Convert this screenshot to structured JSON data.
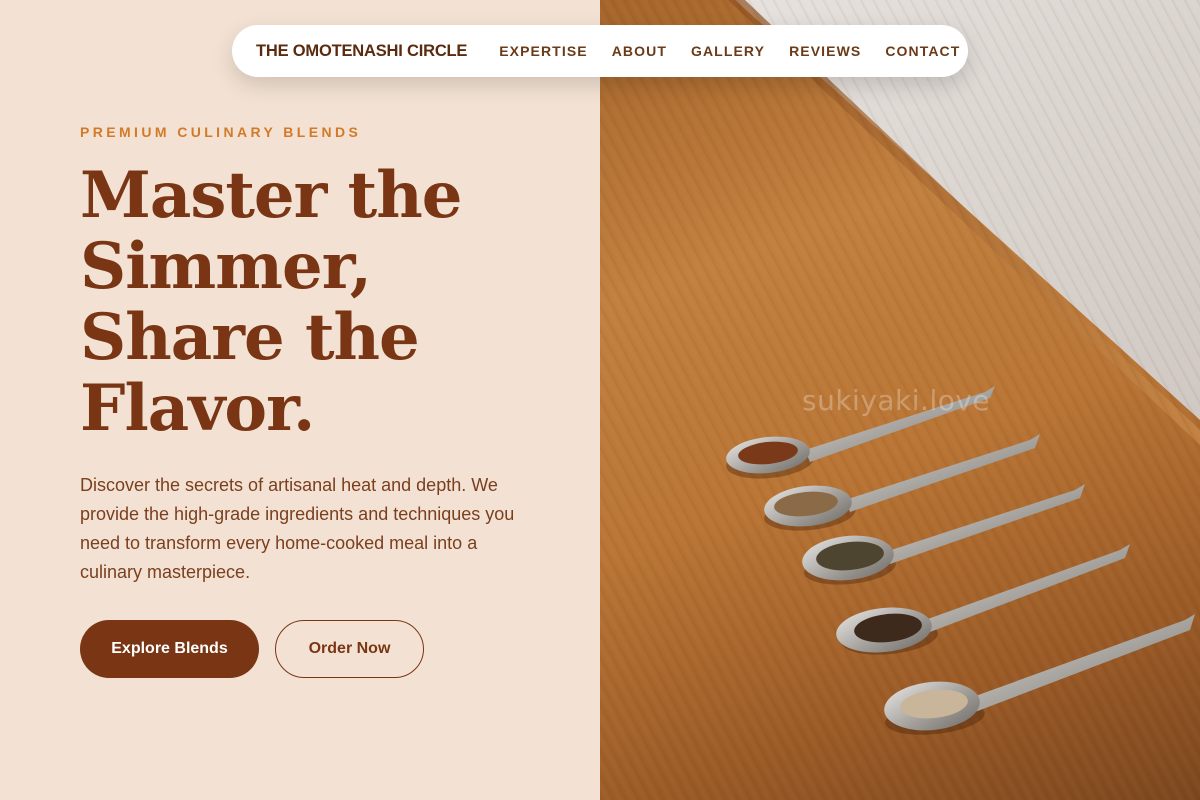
{
  "nav": {
    "brand": "THE OMOTENASHI CIRCLE",
    "links": [
      "EXPERTISE",
      "ABOUT",
      "GALLERY",
      "REVIEWS",
      "CONTACT"
    ]
  },
  "hero": {
    "kicker": "PREMIUM CULINARY BLENDS",
    "headline_lines": [
      "Master the",
      "Simmer,",
      "Share the",
      "Flavor."
    ],
    "description": "Discover the secrets of artisanal heat and depth. We provide the high-grade ingredients and techniques you need to transform every home-cooked meal into a culinary masterpiece.",
    "primary_cta": "Explore Blends",
    "secondary_cta": "Order Now"
  },
  "image": {
    "watermark": "sukiyaki.love",
    "subject": "five spoons of spices on a wooden board"
  },
  "colors": {
    "background": "#f3e2d3",
    "brand_brown": "#7a3614",
    "accent_orange": "#d37a2a"
  }
}
